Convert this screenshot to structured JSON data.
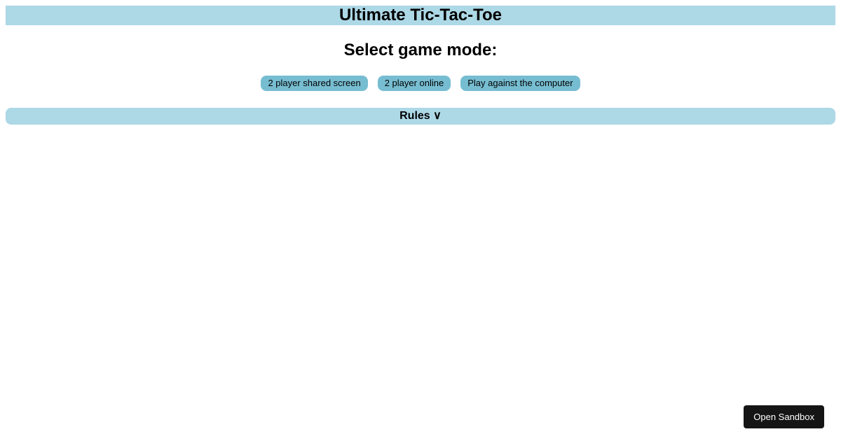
{
  "header": {
    "title": "Ultimate Tic-Tac-Toe"
  },
  "main": {
    "subtitle": "Select game mode:",
    "modes": [
      {
        "label": "2 player shared screen"
      },
      {
        "label": "2 player online"
      },
      {
        "label": "Play against the computer"
      }
    ],
    "rules_label": "Rules ∨"
  },
  "footer": {
    "sandbox_button": "Open Sandbox"
  }
}
